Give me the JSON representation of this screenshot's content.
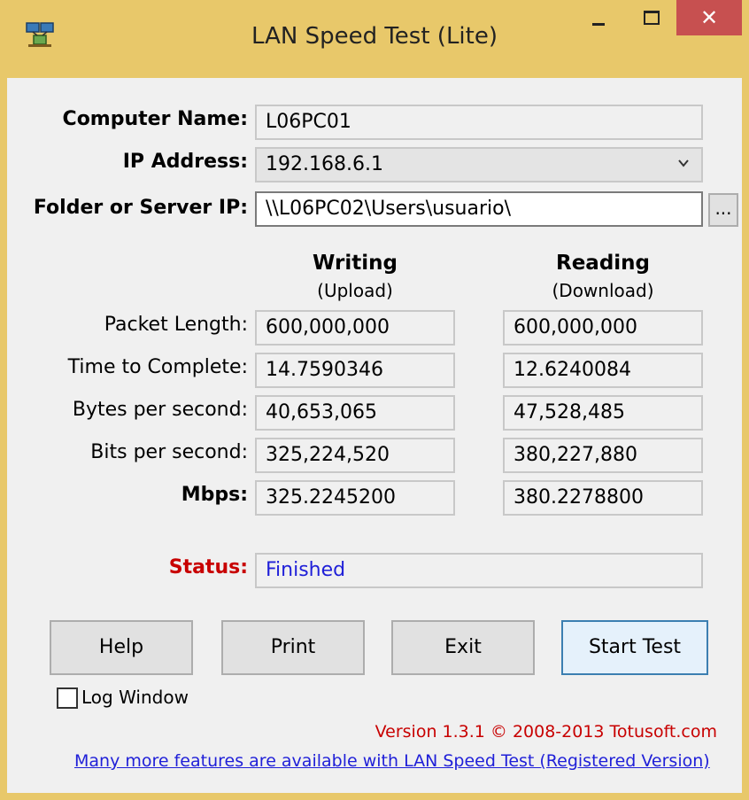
{
  "window": {
    "title": "LAN Speed Test (Lite)",
    "accent_color": "#e8c86a",
    "close_color": "#c75050"
  },
  "form": {
    "computer_name_label": "Computer Name:",
    "computer_name_value": "L06PC01",
    "ip_label": "IP Address:",
    "ip_value": "192.168.6.1",
    "folder_label": "Folder or Server IP:",
    "folder_value": "\\\\L06PC02\\Users\\usuario\\",
    "browse_label": "..."
  },
  "results": {
    "writing_title": "Writing",
    "writing_sub": "(Upload)",
    "reading_title": "Reading",
    "reading_sub": "(Download)",
    "rows": [
      {
        "label": "Packet Length:",
        "writing": "600,000,000",
        "reading": "600,000,000"
      },
      {
        "label": "Time to Complete:",
        "writing": "14.7590346",
        "reading": "12.6240084"
      },
      {
        "label": "Bytes per second:",
        "writing": "40,653,065",
        "reading": "47,528,485"
      },
      {
        "label": "Bits per second:",
        "writing": "325,224,520",
        "reading": "380,227,880"
      },
      {
        "label": "Mbps:",
        "writing": "325.2245200",
        "reading": "380.2278800"
      }
    ]
  },
  "status": {
    "label": "Status:",
    "value": "Finished",
    "label_color": "#c80000",
    "value_color": "#1f1fd8"
  },
  "buttons": {
    "help": "Help",
    "print": "Print",
    "exit": "Exit",
    "start": "Start Test"
  },
  "log_window": {
    "label": "Log Window",
    "checked": false
  },
  "footer": {
    "version": "Version 1.3.1 © 2008-2013 Totusoft.com",
    "link": "Many more features are available with LAN Speed Test (Registered Version)"
  }
}
